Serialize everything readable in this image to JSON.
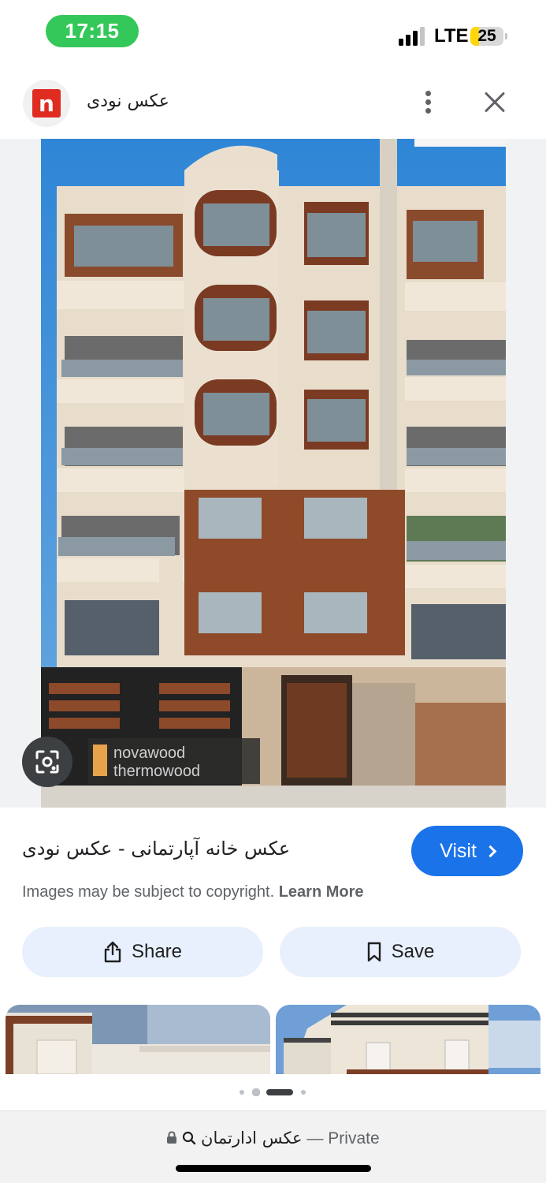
{
  "status_bar": {
    "time": "17:15",
    "network": "LTE",
    "battery": "25",
    "battery_fraction": 0.25,
    "time_pill_color": "#34c759"
  },
  "header": {
    "site_logo_letter": "n",
    "site_name": "عکس نودی",
    "logo_color": "#e02b20"
  },
  "image": {
    "watermark_line1": "novawood",
    "watermark_line2": "thermowood"
  },
  "result": {
    "title": "عکس خانه آپارتمانی - عکس نودی",
    "visit_label": "Visit",
    "copyright_text": "Images may be subject to copyright.",
    "learn_more_label": "Learn More",
    "accent_color": "#1a73e8"
  },
  "actions": {
    "share_label": "Share",
    "save_label": "Save"
  },
  "pager": {
    "active_index": 2,
    "count": 4
  },
  "url_bar": {
    "query": "عکس ادارتمان",
    "separator": "—",
    "mode": "Private"
  },
  "icons": [
    "lock-icon",
    "search-icon",
    "share-icon",
    "bookmark-icon",
    "lens-icon",
    "more-vert-icon",
    "close-icon",
    "chevron-right-icon"
  ]
}
